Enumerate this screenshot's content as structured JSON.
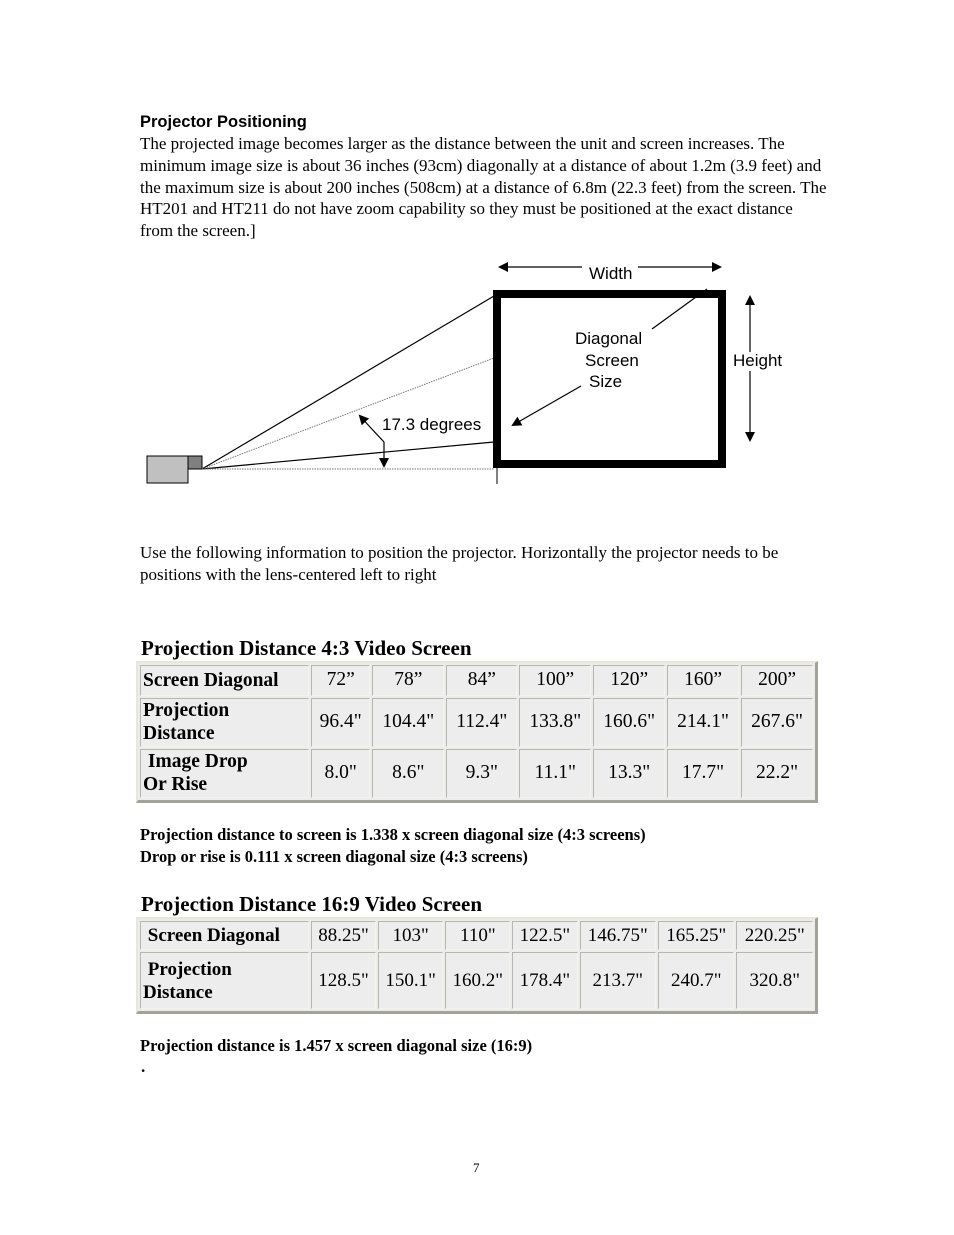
{
  "section": {
    "heading": "Projector Positioning",
    "intro": "The projected image becomes larger as the distance between the unit and screen increases.  The minimum image size is about 36 inches (93cm) diagonally at a distance of about 1.2m (3.9 feet) and the maximum size is about 200 inches (508cm) at a distance of 6.8m (22.3 feet) from the screen. The HT201 and HT211 do not have zoom capability so they must be positioned at the exact distance from the screen.]"
  },
  "diagram": {
    "width_label": "Width",
    "height_label": "Height",
    "diagonal_label_lines": [
      "Diagonal",
      "Screen",
      "Size"
    ],
    "angle_label": "17.3 degrees"
  },
  "positioning_text": "Use the following information to position the projector. Horizontally the projector needs to be positions with the lens-centered left to right",
  "table_4_3": {
    "title": "Projection Distance 4:3 Video Screen",
    "rows": [
      {
        "label": "Screen Diagonal",
        "values": [
          "72”",
          "78”",
          "84”",
          "100”",
          "120”",
          "160”",
          "200”"
        ]
      },
      {
        "label_lines": [
          "Projection",
          "Distance"
        ],
        "values": [
          "96.4\"",
          "104.4\"",
          "112.4\"",
          "133.8\"",
          "160.6\"",
          "214.1\"",
          "267.6\""
        ]
      },
      {
        "label_lines": [
          " Image Drop",
          "Or Rise"
        ],
        "values": [
          "8.0\"",
          "8.6\"",
          "9.3\"",
          "11.1\"",
          "13.3\"",
          "17.7\"",
          "22.2\""
        ]
      }
    ],
    "notes": [
      "Projection distance to screen is 1.338 x screen diagonal size (4:3 screens)",
      "Drop or rise is 0.111 x screen diagonal size (4:3 screens)"
    ]
  },
  "table_16_9": {
    "title": "Projection Distance 16:9 Video Screen",
    "rows": [
      {
        "label": " Screen Diagonal",
        "values": [
          "88.25\"",
          "103\"",
          "110\"",
          "122.5\"",
          "146.75\"",
          "165.25\"",
          "220.25\""
        ]
      },
      {
        "label_lines": [
          " Projection",
          "Distance"
        ],
        "values": [
          "128.5\"",
          "150.1\"",
          "160.2\"",
          "178.4\"",
          "213.7\"",
          "240.7\"",
          "320.8\""
        ]
      }
    ],
    "note": "Projection distance is 1.457 x screen diagonal size (16:9)",
    "trailing": "."
  },
  "page_number": "7"
}
